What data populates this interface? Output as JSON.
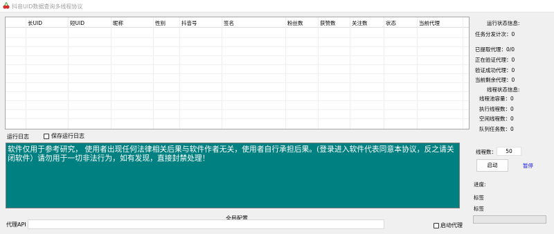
{
  "window": {
    "title": "抖音UID数据查询多线程协议"
  },
  "table": {
    "columns": [
      "长UID",
      "短UID",
      "昵称",
      "性别",
      "抖音号",
      "签名",
      "粉丝数",
      "获赞数",
      "关注数",
      "状态",
      "当前代理"
    ]
  },
  "log": {
    "label": "运行日志",
    "save_label": "保存运行日志",
    "text": "软件仅用于参考研究， 使用者出现任何法律相关后果与软件作者无关，使用者自行承担后果。(登录进入软件代表同意本协议，反之请关闭软件）请勿用于一切非法行为，如有发现，直接封禁处理！"
  },
  "config": {
    "title": "全局配置",
    "proxy_api_label": "代理API",
    "proxy_api_value": "",
    "auto_proxy_label": "启动代理"
  },
  "status": {
    "header": "运行状态信息:",
    "task_total": "任务分发计次：0",
    "proxy_fetched": "已提取代理：0/0",
    "proxy_verifying": "正在验证代理：0",
    "proxy_verified": "验证成功代理：0",
    "proxy_remaining": "当前剩余代理：0"
  },
  "threads": {
    "header": "线程状态信息:",
    "capacity": "线程池容量：0",
    "executing": "执行线程数：0",
    "idle": "空闲线程数：0",
    "queued": "队列任务数：0"
  },
  "controls": {
    "thread_count_label": "线程数：",
    "thread_count_value": "50",
    "start_label": "启动",
    "pause_label": "暂停",
    "progress_label": "进度:",
    "tag1": "标签",
    "tag2": "标签",
    "progress_value": 0
  }
}
